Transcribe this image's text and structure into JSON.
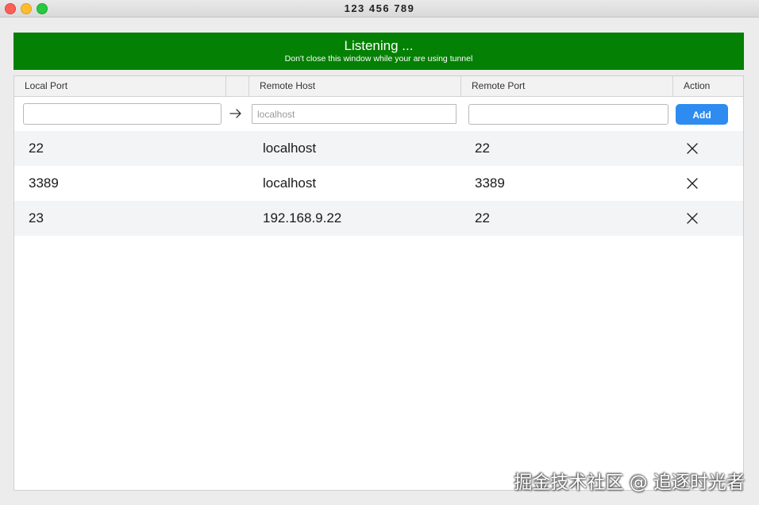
{
  "window": {
    "title": "123 456 789"
  },
  "banner": {
    "title": "Listening ...",
    "subtitle": "Don't close this window while your are using tunnel",
    "color": "#048004"
  },
  "table": {
    "headers": {
      "local_port": "Local Port",
      "arrow": "",
      "remote_host": "Remote Host",
      "remote_port": "Remote Port",
      "action": "Action"
    },
    "form": {
      "local_port_value": "",
      "remote_host_placeholder": "localhost",
      "remote_port_value": "",
      "add_label": "Add",
      "arrow_icon": "arrow-right-icon"
    },
    "rows": [
      {
        "local_port": "22",
        "remote_host": "localhost",
        "remote_port": "22"
      },
      {
        "local_port": "3389",
        "remote_host": "localhost",
        "remote_port": "3389"
      },
      {
        "local_port": "23",
        "remote_host": "192.168.9.22",
        "remote_port": "22"
      }
    ],
    "delete_icon": "close-icon"
  },
  "accent": "#2e8cf0",
  "watermark": "掘金技术社区 @ 追逐时光者"
}
